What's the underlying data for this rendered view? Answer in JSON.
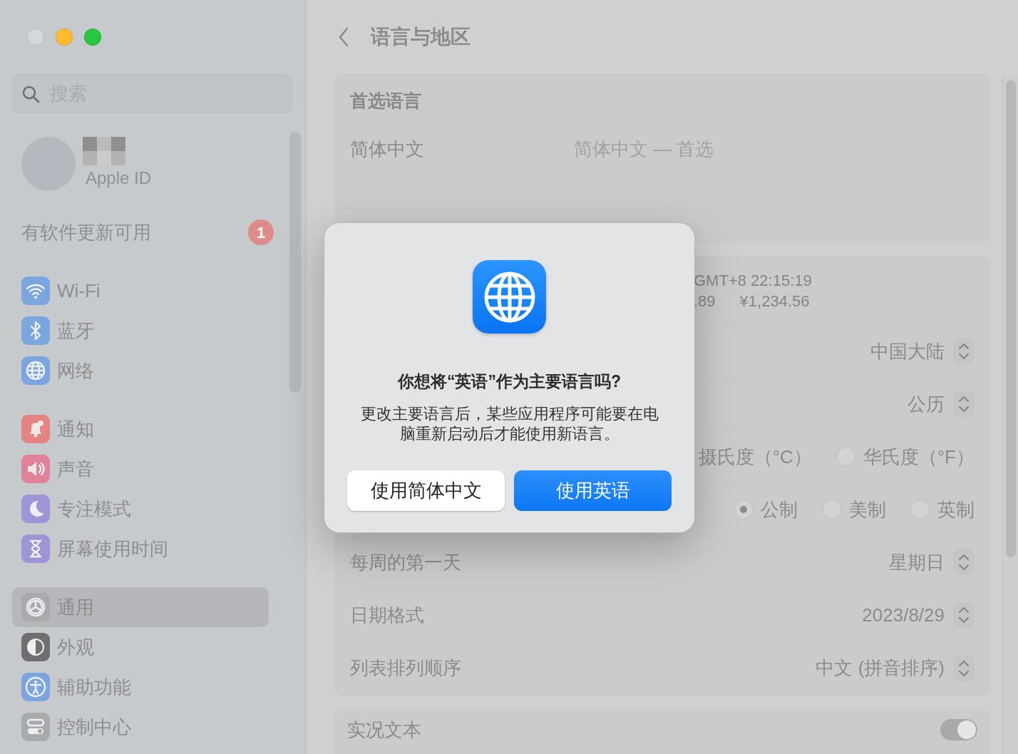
{
  "window": {
    "controls": [
      {
        "color": "#d3d9da"
      },
      {
        "color": "#febc2e"
      },
      {
        "color": "#28c840"
      }
    ]
  },
  "sidebar": {
    "search": {
      "placeholder": "搜索"
    },
    "account": {
      "label": "Apple ID"
    },
    "update": {
      "label": "有软件更新可用",
      "badge": "1"
    },
    "groups": [
      [
        {
          "label": "Wi-Fi",
          "kind": "wifi",
          "color": "#7aa5de",
          "selected": false
        },
        {
          "label": "蓝牙",
          "kind": "bluetooth",
          "color": "#7aa5de",
          "selected": false
        },
        {
          "label": "网络",
          "kind": "globe",
          "color": "#7aa5de",
          "selected": false
        }
      ],
      [
        {
          "label": "通知",
          "kind": "bell",
          "color": "#e38482",
          "selected": false
        },
        {
          "label": "声音",
          "kind": "speaker",
          "color": "#e2829a",
          "selected": false
        },
        {
          "label": "专注模式",
          "kind": "moon",
          "color": "#9d95d6",
          "selected": false
        },
        {
          "label": "屏幕使用时间",
          "kind": "hourglass",
          "color": "#9d95d6",
          "selected": false
        }
      ],
      [
        {
          "label": "通用",
          "kind": "gear",
          "color": "#a9aaac",
          "selected": true
        },
        {
          "label": "外观",
          "kind": "appearance",
          "color": "#6f6f71",
          "selected": false
        },
        {
          "label": "辅助功能",
          "kind": "accessibility",
          "color": "#7aa5de",
          "selected": false
        },
        {
          "label": "控制中心",
          "kind": "switches",
          "color": "#a9aaac",
          "selected": false
        }
      ]
    ]
  },
  "header": {
    "title": "语言与地区"
  },
  "preferred_languages": {
    "title": "首选语言",
    "items": [
      {
        "name": "简体中文",
        "detail": "简体中文 — 首选"
      }
    ]
  },
  "format": {
    "preview": [
      [
        "GMT+8 22:15:19"
      ],
      [
        ".89",
        "¥1,234.56"
      ]
    ],
    "rows": [
      {
        "kind": "popup",
        "value": "中国大陆"
      },
      {
        "kind": "popup",
        "value": "公历"
      },
      {
        "kind": "radio",
        "options": [
          {
            "label": "摄氏度（°C）"
          },
          {
            "label": "华氏度（°F）",
            "selected": false
          }
        ]
      },
      {
        "kind": "radio",
        "options": [
          {
            "label": "公制",
            "selected": true
          },
          {
            "label": "美制",
            "selected": false
          },
          {
            "label": "英制",
            "selected": false
          }
        ]
      },
      {
        "kind": "popup",
        "label": "每周的第一天",
        "value": "星期日"
      },
      {
        "kind": "popup",
        "label": "日期格式",
        "value": "2023/8/29"
      },
      {
        "kind": "popup",
        "label": "列表排列顺序",
        "value": "中文 (拼音排序)"
      }
    ]
  },
  "live_text": {
    "title": "实况文本",
    "on": true
  },
  "dialog": {
    "title": "你想将“英语”作为主要语言吗?",
    "message": "更改主要语言后，某些应用程序可能要在电脑重新启动后才能使用新语言。",
    "buttons": [
      {
        "label": "使用简体中文",
        "default": false
      },
      {
        "label": "使用英语",
        "default": true
      }
    ]
  }
}
